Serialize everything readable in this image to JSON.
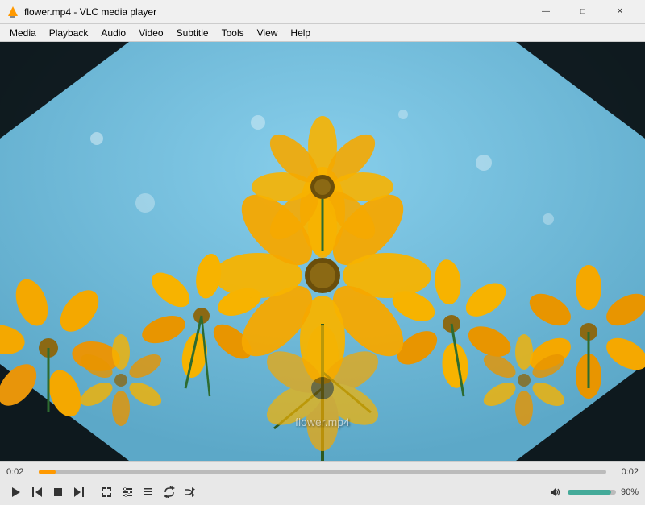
{
  "titleBar": {
    "icon": "vlc-icon",
    "title": "flower.mp4 - VLC media player"
  },
  "windowControls": {
    "minimize": "—",
    "maximize": "□",
    "close": "✕"
  },
  "menuBar": {
    "items": [
      "Media",
      "Playback",
      "Audio",
      "Video",
      "Subtitle",
      "Tools",
      "View",
      "Help"
    ]
  },
  "videoArea": {
    "watermark": "flower.mp4"
  },
  "controls": {
    "timeElapsed": "0:02",
    "timeTotal": "0:02",
    "progressPercent": 3,
    "volumePercent": 90,
    "volumeLabel": "90%",
    "buttons": {
      "play": "▶",
      "skipBack": "⏮",
      "stop": "■",
      "skipForward": "⏭",
      "fullscreen": "⛶",
      "extended": "≡≡",
      "playlist": "☰",
      "loop": "↺",
      "random": "⇄",
      "mute": "🔊"
    }
  }
}
